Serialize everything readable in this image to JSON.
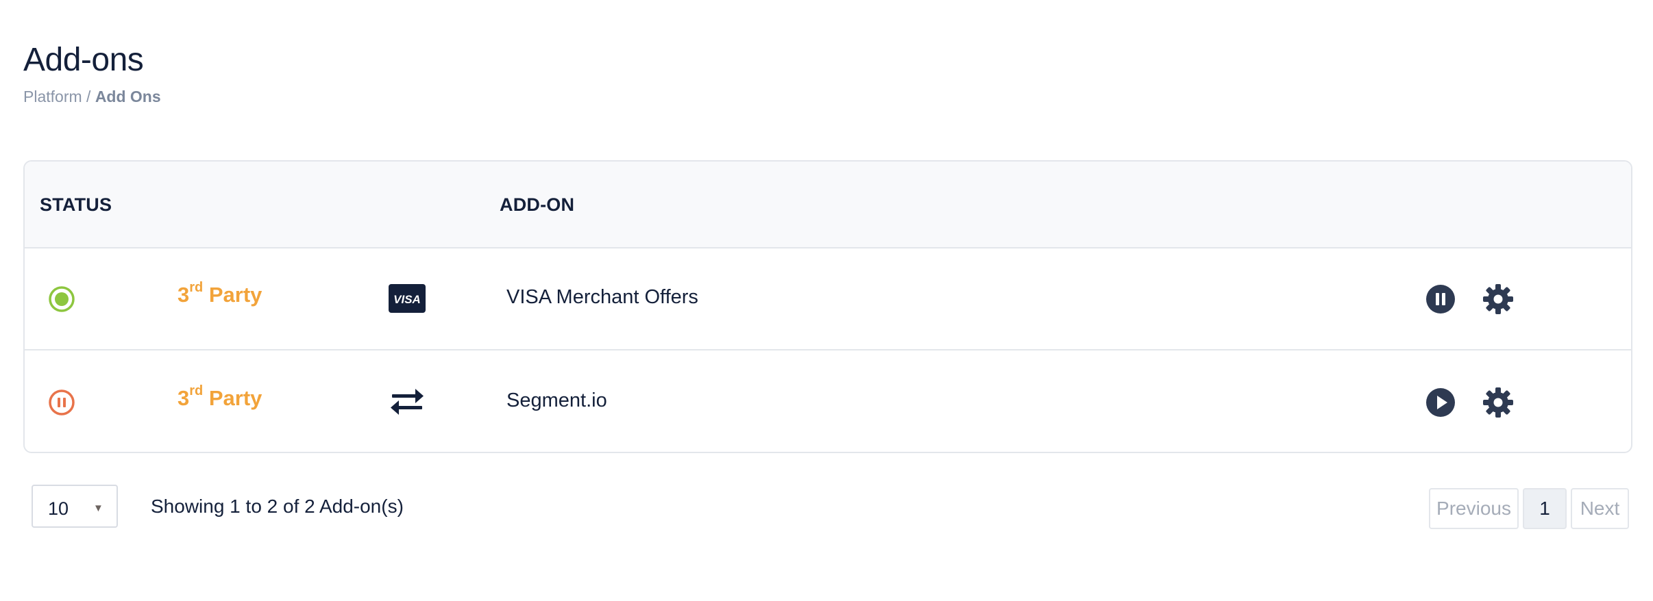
{
  "header": {
    "title": "Add-ons",
    "breadcrumb": {
      "parent": "Platform",
      "separator": " / ",
      "current": "Add Ons"
    }
  },
  "table": {
    "columns": {
      "status": "STATUS",
      "addon": "ADD-ON"
    },
    "rows": [
      {
        "status": "active",
        "status_icon": "radio-active-icon",
        "type_prefix": "3",
        "type_sup": "rd",
        "type_suffix": " Party",
        "brand_icon": "visa-logo-icon",
        "brand_label": "VISA",
        "name": "VISA Merchant Offers",
        "action_icon": "pause-circle-icon",
        "settings_icon": "gear-icon"
      },
      {
        "status": "paused",
        "status_icon": "pause-status-icon",
        "type_prefix": "3",
        "type_sup": "rd",
        "type_suffix": " Party",
        "brand_icon": "swap-arrows-icon",
        "name": "Segment.io",
        "action_icon": "play-circle-icon",
        "settings_icon": "gear-icon"
      }
    ]
  },
  "footer": {
    "page_size": "10",
    "showing": "Showing 1 to 2 of 2 Add-on(s)",
    "pager": {
      "previous": "Previous",
      "current_page": "1",
      "next": "Next"
    }
  },
  "colors": {
    "text_dark": "#14203a",
    "accent_orange": "#f2a33a",
    "status_active": "#8dc63f",
    "status_paused": "#e8734a",
    "icon_dark": "#2e3a52",
    "border": "#e3e6eb"
  }
}
